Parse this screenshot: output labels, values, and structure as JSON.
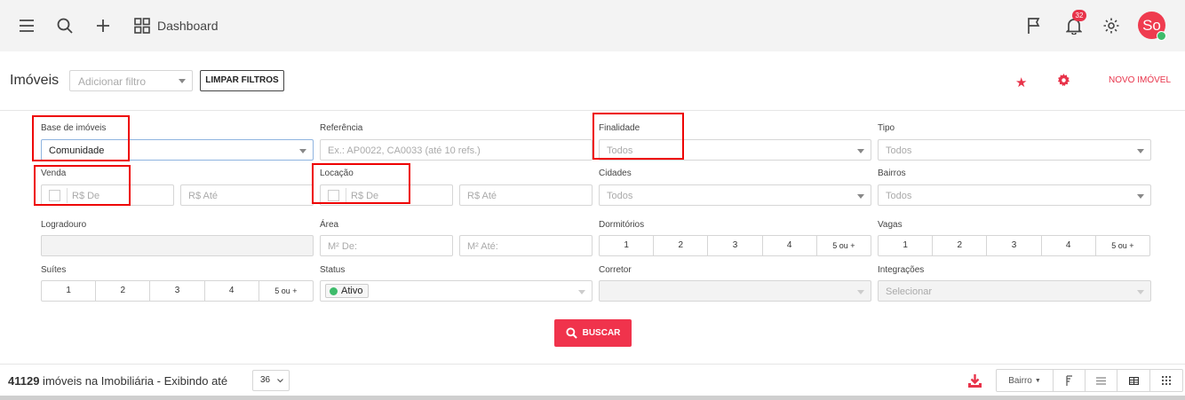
{
  "topbar": {
    "dashboard_label": "Dashboard",
    "notifications_count": "32",
    "avatar_initials": "So"
  },
  "toolbar": {
    "title": "Imóveis",
    "filter_placeholder": "Adicionar filtro",
    "clear_filters": "LIMPAR FILTROS",
    "new_property": "NOVO IMÓVEL"
  },
  "filters": {
    "base": {
      "label": "Base de imóveis",
      "value": "Comunidade"
    },
    "referencia": {
      "label": "Referência",
      "placeholder": "Ex.: AP0022, CA0033 (até 10 refs.)"
    },
    "finalidade": {
      "label": "Finalidade",
      "placeholder": "Todos"
    },
    "tipo": {
      "label": "Tipo",
      "placeholder": "Todos"
    },
    "venda": {
      "label": "Venda",
      "from": "R$ De",
      "to": "R$ Até"
    },
    "locacao": {
      "label": "Locação",
      "from": "R$ De",
      "to": "R$ Até"
    },
    "cidades": {
      "label": "Cidades",
      "placeholder": "Todos"
    },
    "bairros": {
      "label": "Bairros",
      "placeholder": "Todos"
    },
    "logradouro": {
      "label": "Logradouro"
    },
    "area": {
      "label": "Área",
      "from": "M² De:",
      "to": "M² Até:"
    },
    "dormitorios": {
      "label": "Dormitórios",
      "options": [
        "1",
        "2",
        "3",
        "4",
        "5 ou +"
      ]
    },
    "vagas": {
      "label": "Vagas",
      "options": [
        "1",
        "2",
        "3",
        "4",
        "5 ou +"
      ]
    },
    "suites": {
      "label": "Suítes",
      "options": [
        "1",
        "2",
        "3",
        "4",
        "5 ou +"
      ]
    },
    "status": {
      "label": "Status",
      "value": "Ativo"
    },
    "corretor": {
      "label": "Corretor"
    },
    "integracoes": {
      "label": "Integrações",
      "placeholder": "Selecionar"
    }
  },
  "search_button": "BUSCAR",
  "footer": {
    "count": "41129",
    "count_suffix": " imóveis na Imobiliária - Exibindo até",
    "per_page": "36",
    "sort_label": "Bairro"
  },
  "colors": {
    "accent": "#f0334c",
    "status_active": "#3dbb6a",
    "annotation": "#e00000"
  }
}
